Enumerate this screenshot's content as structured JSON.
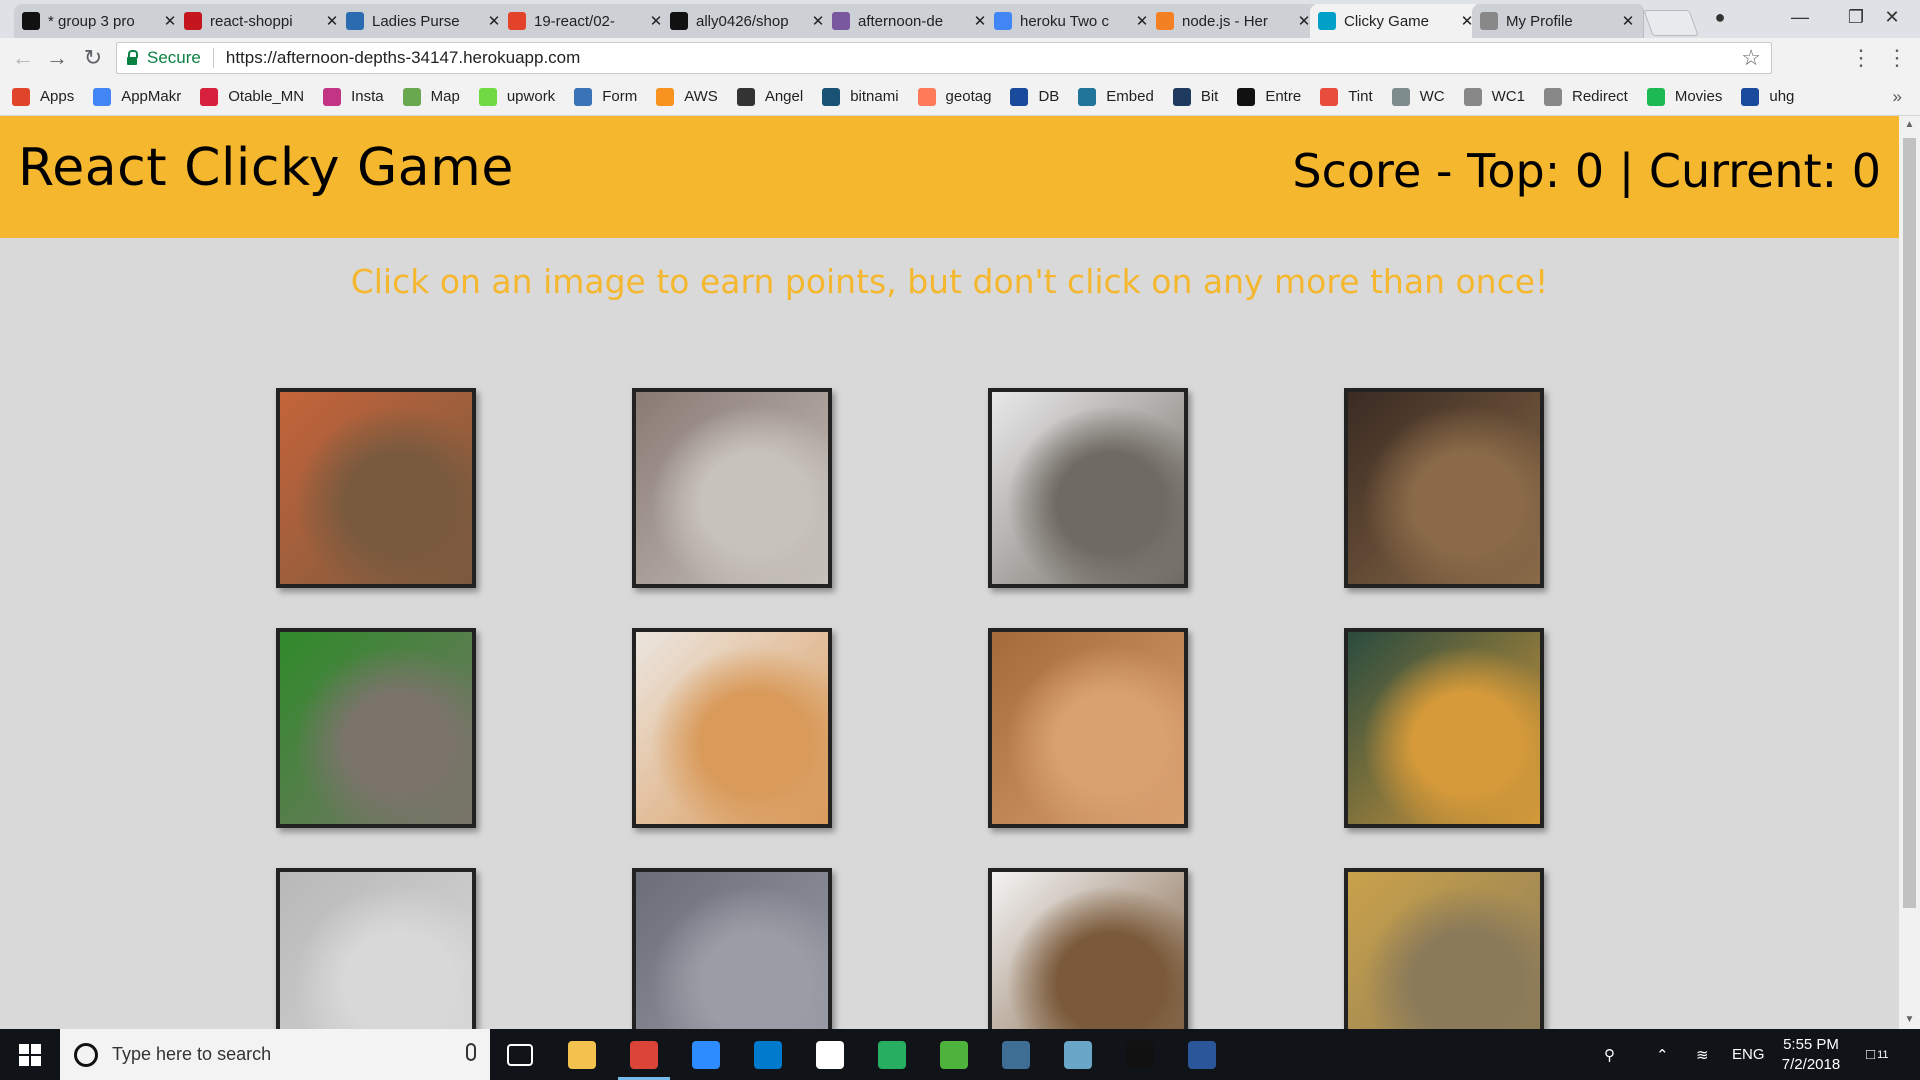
{
  "tabs": [
    {
      "title": "* group 3 pro",
      "icon": "trello-icon",
      "color": "#111111"
    },
    {
      "title": "react-shoppi",
      "icon": "mall-icon",
      "color": "#c4161c"
    },
    {
      "title": "Ladies Purse",
      "icon": "purse-icon",
      "color": "#2b6cb0"
    },
    {
      "title": "19-react/02-",
      "icon": "gitlab-icon",
      "color": "#e24329"
    },
    {
      "title": "ally0426/shop",
      "icon": "github-icon",
      "color": "#111111"
    },
    {
      "title": "afternoon-de",
      "icon": "heroku-icon",
      "color": "#79589f"
    },
    {
      "title": "heroku Two c",
      "icon": "google-icon",
      "color": "#4285f4"
    },
    {
      "title": "node.js - Her",
      "icon": "stackoverflow-icon",
      "color": "#f48024"
    },
    {
      "title": "Clicky Game",
      "icon": "react-icon",
      "color": "#00a0c8",
      "active": true
    },
    {
      "title": "My Profile",
      "icon": "page-icon",
      "color": "#888888"
    }
  ],
  "address": {
    "secure_label": "Secure",
    "url": "https://afternoon-depths-34147.herokuapp.com"
  },
  "bookmarks": [
    {
      "label": "Apps",
      "icon": "apps-grid-icon",
      "color": "#e0452c"
    },
    {
      "label": "AppMakr",
      "icon": "google-icon",
      "color": "#4285f4"
    },
    {
      "label": "Otable_MN",
      "icon": "otable-icon",
      "color": "#d6213c"
    },
    {
      "label": "Insta",
      "icon": "instagram-icon",
      "color": "#c13584"
    },
    {
      "label": "Map",
      "icon": "map-icon",
      "color": "#6aa84f"
    },
    {
      "label": "upwork",
      "icon": "upwork-icon",
      "color": "#6fda44"
    },
    {
      "label": "Form",
      "icon": "form-icon",
      "color": "#3b73b9"
    },
    {
      "label": "AWS",
      "icon": "aws-icon",
      "color": "#f7931e"
    },
    {
      "label": "Angel",
      "icon": "angel-icon",
      "color": "#333333"
    },
    {
      "label": "bitnami",
      "icon": "bitnami-icon",
      "color": "#1a5276"
    },
    {
      "label": "geotag",
      "icon": "hubspot-icon",
      "color": "#ff7a59"
    },
    {
      "label": "DB",
      "icon": "db-icon",
      "color": "#1a4a9c"
    },
    {
      "label": "Embed",
      "icon": "wordpress-icon",
      "color": "#21759b"
    },
    {
      "label": "Bit",
      "icon": "bit-icon",
      "color": "#1f3a5f"
    },
    {
      "label": "Entre",
      "icon": "entre-icon",
      "color": "#111111"
    },
    {
      "label": "Tint",
      "icon": "tint-icon",
      "color": "#e74c3c"
    },
    {
      "label": "WC",
      "icon": "wc-icon",
      "color": "#7f8c8d"
    },
    {
      "label": "WC1",
      "icon": "page-icon",
      "color": "#888888"
    },
    {
      "label": "Redirect",
      "icon": "page-icon",
      "color": "#888888"
    },
    {
      "label": "Movies",
      "icon": "play-icon",
      "color": "#1db954"
    },
    {
      "label": "uhg",
      "icon": "ls-icon",
      "color": "#1a4a9c"
    }
  ],
  "game": {
    "title": "React Clicky Game",
    "score_label": "Score - Top: 0 | Current: 0",
    "instructions": "Click on an image to earn points, but don't click on any more than once!",
    "accent": "#f5b72e",
    "cards": [
      {
        "name": "tabby-cat-by-fence",
        "colors": [
          "#c4643a",
          "#7a5a3e"
        ]
      },
      {
        "name": "gray-cat-closeup",
        "colors": [
          "#8a7a74",
          "#c8c2bc"
        ]
      },
      {
        "name": "gray-cat-on-bed",
        "colors": [
          "#e9e9ea",
          "#6f6a62"
        ]
      },
      {
        "name": "cat-in-basket",
        "colors": [
          "#3a2b22",
          "#8a6a48"
        ]
      },
      {
        "name": "tabby-cat-on-mat",
        "colors": [
          "#2f8a2a",
          "#7a746a"
        ]
      },
      {
        "name": "orange-cat-sleeping",
        "colors": [
          "#ece6df",
          "#d99a5a"
        ]
      },
      {
        "name": "fluffy-orange-cat",
        "colors": [
          "#a46a3a",
          "#d9a070"
        ]
      },
      {
        "name": "siamese-kitten",
        "colors": [
          "#2a4b3e",
          "#d69a3a"
        ]
      },
      {
        "name": "cat-peeking",
        "colors": [
          "#b8b8b8",
          "#d8d8d8"
        ]
      },
      {
        "name": "gray-cat-licking",
        "colors": [
          "#6b6e78",
          "#9a9ca6"
        ]
      },
      {
        "name": "kitten-on-chair",
        "colors": [
          "#f3f3f3",
          "#7a5a3a"
        ]
      },
      {
        "name": "tabby-cat-napping",
        "colors": [
          "#c9a24a",
          "#8a7a5a"
        ]
      }
    ]
  },
  "taskbar": {
    "search_placeholder": "Type here to search",
    "apps": [
      {
        "name": "task-view-icon",
        "color": "#101418"
      },
      {
        "name": "file-explorer-icon",
        "color": "#f2c14e"
      },
      {
        "name": "chrome-icon",
        "color": "#db4437",
        "open": true
      },
      {
        "name": "zoom-icon",
        "color": "#2d8cff"
      },
      {
        "name": "vscode-icon",
        "color": "#007acc"
      },
      {
        "name": "slack-icon",
        "color": "#ffffff"
      },
      {
        "name": "git-kraken-icon",
        "color": "#27ae60"
      },
      {
        "name": "mongodb-icon",
        "color": "#4db33d"
      },
      {
        "name": "mysql-workbench-icon",
        "color": "#3e6e93"
      },
      {
        "name": "notes-icon",
        "color": "#6aa6c8"
      },
      {
        "name": "intellij-icon",
        "color": "#111111"
      },
      {
        "name": "word-icon",
        "color": "#2b579a"
      }
    ],
    "language": "ENG",
    "time": "5:55 PM",
    "date": "7/2/2018",
    "notification_count": "11"
  }
}
